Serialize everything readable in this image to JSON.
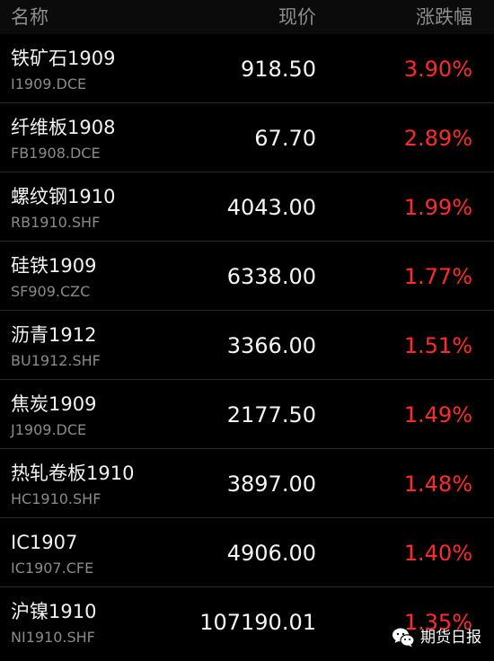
{
  "header": {
    "name_label": "名称",
    "price_label": "现价",
    "change_label": "涨跌幅"
  },
  "rows": [
    {
      "name": "铁矿石1909",
      "code": "I1909.DCE",
      "price": "918.50",
      "change": "3.90%"
    },
    {
      "name": "纤维板1908",
      "code": "FB1908.DCE",
      "price": "67.70",
      "change": "2.89%"
    },
    {
      "name": "螺纹钢1910",
      "code": "RB1910.SHF",
      "price": "4043.00",
      "change": "1.99%"
    },
    {
      "name": "硅铁1909",
      "code": "SF909.CZC",
      "price": "6338.00",
      "change": "1.77%"
    },
    {
      "name": "沥青1912",
      "code": "BU1912.SHF",
      "price": "3366.00",
      "change": "1.51%"
    },
    {
      "name": "焦炭1909",
      "code": "J1909.DCE",
      "price": "2177.50",
      "change": "1.49%"
    },
    {
      "name": "热轧卷板1910",
      "code": "HC1910.SHF",
      "price": "3897.00",
      "change": "1.48%"
    },
    {
      "name": "IC1907",
      "code": "IC1907.CFE",
      "price": "4906.00",
      "change": "1.40%"
    },
    {
      "name": "沪镍1910",
      "code": "NI1910.SHF",
      "price": "107190.01",
      "change": "1.35%"
    }
  ],
  "watermark": {
    "text": "期货日报",
    "icon": "wechat-icon"
  },
  "colors": {
    "up": "#ff2a2a",
    "background": "#000000",
    "header_text": "#8d8d8d"
  }
}
